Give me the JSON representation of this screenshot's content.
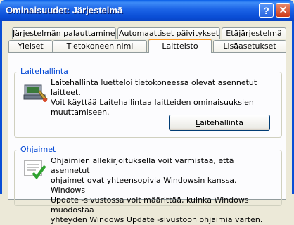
{
  "window": {
    "title": "Ominaisuudet: Järjestelmä",
    "help_glyph": "?",
    "close_glyph": "✕"
  },
  "tabs_back": [
    "Järjestelmän palauttaminen",
    "Automaattiset päivitykset",
    "Etäjärjestelmä"
  ],
  "tabs_front": [
    "Yleiset",
    "Tietokoneen nimi",
    "Laitteisto",
    "Lisäasetukset"
  ],
  "active_tab": "Laitteisto",
  "device_manager": {
    "title": "Laitehallinta",
    "lines": [
      "Laitehallinta luetteloi tietokoneessa olevat asennetut laitteet.",
      "Voit käyttää Laitehallintaa laitteiden ominaisuuksien",
      "muuttamiseen."
    ],
    "button_first": "L",
    "button_rest": "aitehallinta",
    "icon": "device-manager-icon"
  },
  "drivers": {
    "title": "Ohjaimet",
    "lines": [
      "Ohjaimien allekirjoituksella voit varmistaa, että asennetut",
      "ohjaimet ovat yhteensopivia Windowsin kanssa. Windows",
      "Update -sivustossa voit määrittää, kuinka Windows muodostaa",
      "yhteyden Windows Update -sivustoon ohjaimia varten."
    ],
    "icon": "driver-signing-icon"
  }
}
